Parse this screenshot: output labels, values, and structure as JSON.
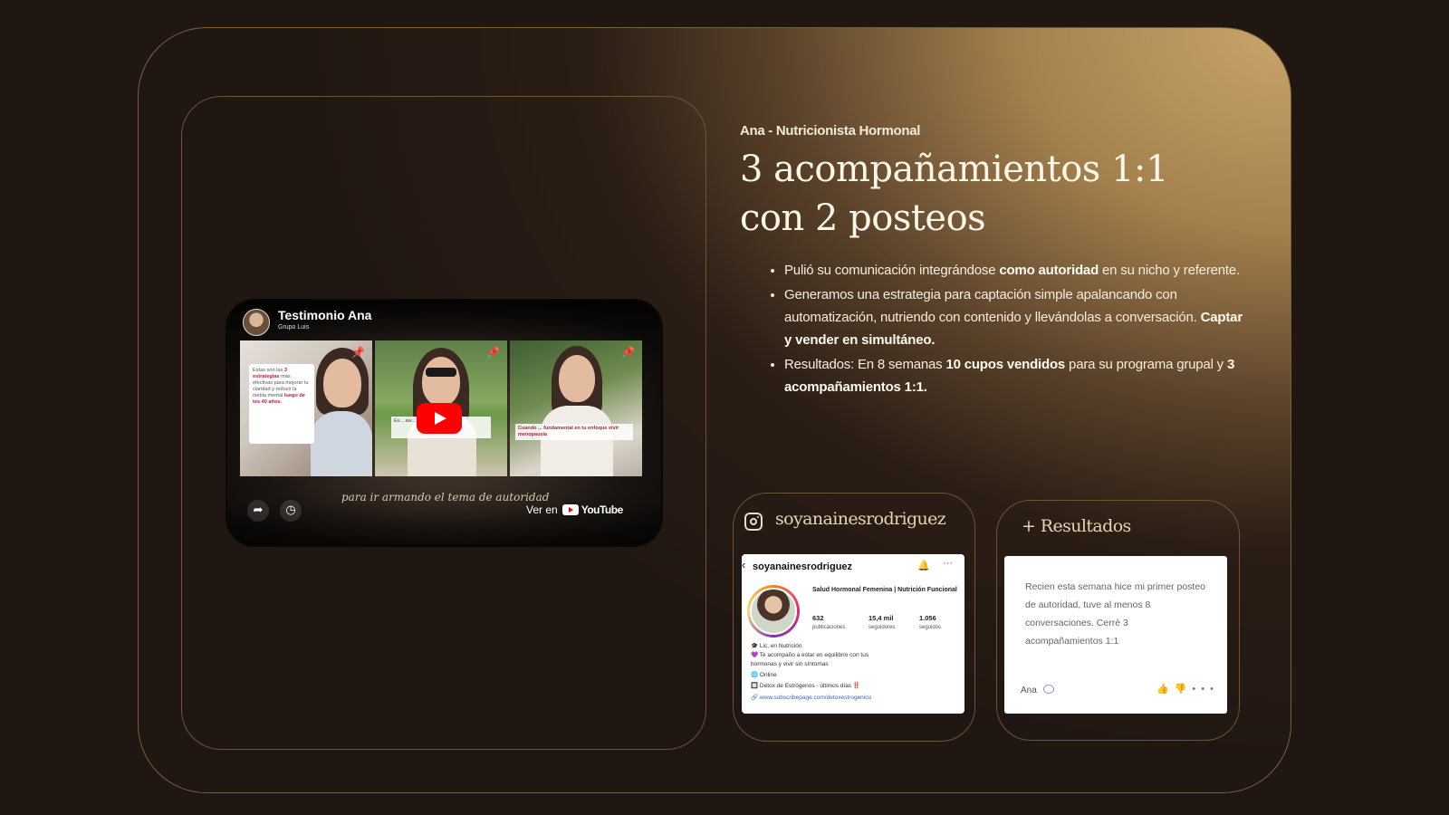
{
  "video": {
    "title": "Testimonio Ana",
    "channel": "Grupo Luis",
    "thumb1_card": {
      "line1": "Estas son las",
      "highlight": "3 estrategias",
      "line2": "más efectivas para mejorar tu claridad y reducir la niebla mental",
      "highlight2": "luego de los 40 años."
    },
    "thumb2_caption": "Es... aw...",
    "thumb3_caption": "Cuando ... fundamental en tu enfoque vivir menopausia",
    "subtitle": "para ir armando el tema de autoridad",
    "watch_on": "Ver en",
    "youtube_word": "YouTube"
  },
  "content": {
    "eyebrow": "Ana - Nutricionista Hormonal",
    "headline": "3 acompañamientos 1:1 con 2 posteos",
    "bullets": [
      {
        "parts": [
          {
            "t": "Pulió su comunicación integrándose ",
            "b": false
          },
          {
            "t": "como autoridad",
            "b": true
          },
          {
            "t": " en su nicho y referente.",
            "b": false
          }
        ]
      },
      {
        "parts": [
          {
            "t": "Generamos una estrategia para captación simple apalancando con automatización, nutriendo con contenido y llevándolas a conversación. ",
            "b": false
          },
          {
            "t": "Captar y vender en simultáneo.",
            "b": true
          }
        ]
      },
      {
        "parts": [
          {
            "t": "Resultados: En 8 semanas ",
            "b": false
          },
          {
            "t": "10 cupos vendidos",
            "b": true
          },
          {
            "t": " para su programa grupal y ",
            "b": false
          },
          {
            "t": "3 acompañamientos 1:1.",
            "b": true
          }
        ]
      }
    ]
  },
  "instagram": {
    "handle": "soyanainesrodriguez",
    "profile_name": "soyanainesrodriguez",
    "bio_title": "Salud Hormonal Femenina | Nutrición Funcional",
    "stats": [
      {
        "value": "632",
        "label": "publicaciones"
      },
      {
        "value": "15,4 mil",
        "label": "seguidores"
      },
      {
        "value": "1.056",
        "label": "seguidos"
      }
    ],
    "bio_lines": [
      "🎓 Lic. en Nutrición",
      "💜 Te acompaño a estar en equilibrio con tus",
      "hormonas y vivir sin síntomas",
      "🌐 Online",
      "🔲 Detox de Estrógenos - últimos días ‼️"
    ],
    "link": "www.subscribepage.com/detoxestrogenico"
  },
  "results": {
    "title": "+ Resultados",
    "message": "Recien esta semana hice mi primer posteo de autoridad, tuve al menos 8 conversaciones. Cerré 3 acompañamientos 1:1",
    "author": "Ana"
  }
}
